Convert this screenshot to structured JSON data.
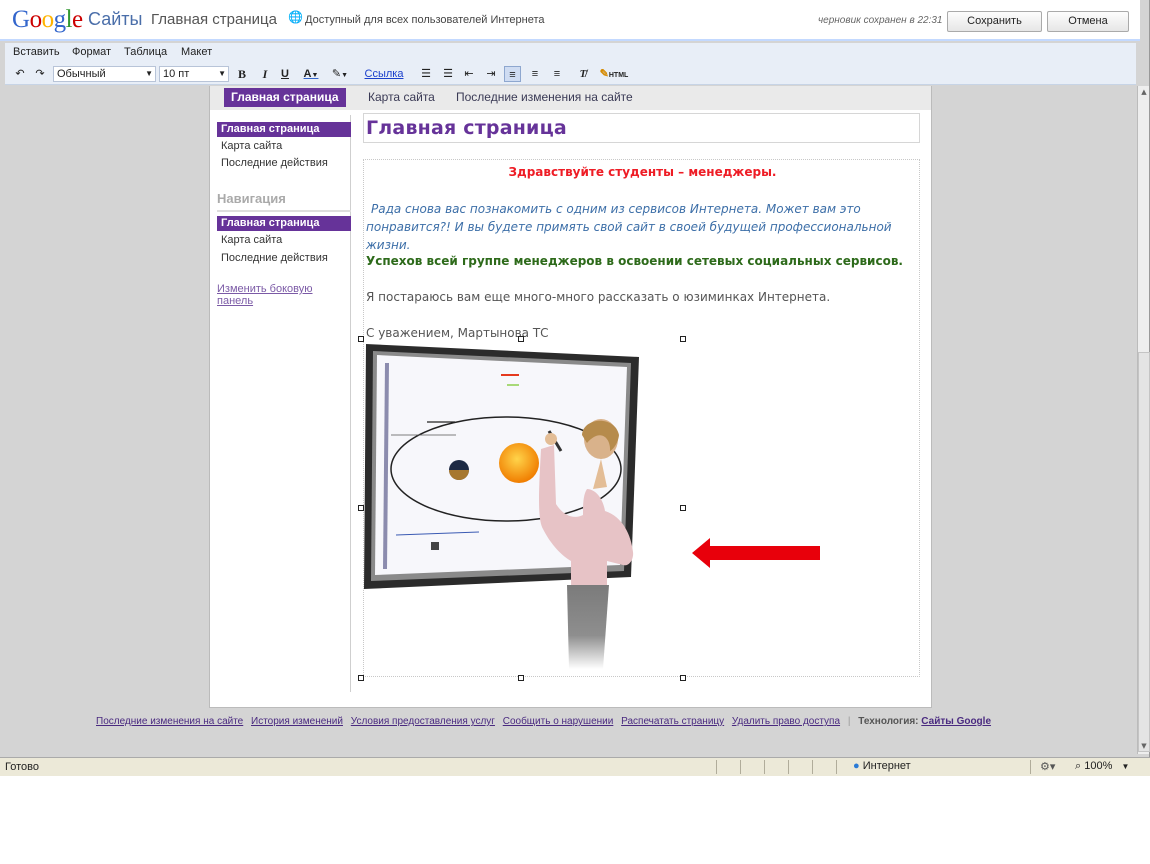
{
  "header": {
    "logo": "Google",
    "product": "Сайты",
    "page_name": "Главная страница",
    "access_text": "Доступный для всех пользователей Интернета",
    "draft_text": "черновик сохранен в 22:31",
    "save_label": "Сохранить",
    "cancel_label": "Отмена"
  },
  "menu": [
    "Вставить",
    "Формат",
    "Таблица",
    "Макет"
  ],
  "toolbar": {
    "style_value": "Обычный",
    "size_value": "10 пт",
    "bold": "B",
    "italic": "I",
    "underline": "U",
    "text_color": "A",
    "link_label": "Ссылка",
    "html_label": "HTML"
  },
  "tabs": [
    "Главная страница",
    "Карта сайта",
    "Последние изменения на сайте"
  ],
  "sidebar": {
    "top_items": [
      "Главная страница",
      "Карта сайта",
      "Последние действия"
    ],
    "nav_title": "Навигация",
    "nav_items": [
      "Главная страница",
      "Карта сайта",
      "Последние действия"
    ],
    "edit_link": "Изменить боковую панель"
  },
  "page": {
    "title": "Главная страница",
    "greeting": "Здравствуйте студенты – менеджеры.",
    "intro": "Рада снова вас познакомить с одним из сервисов Интернета. Может вам это понравится?! И вы будете примять свой сайт в своей будущей профессиональной жизни.",
    "wish": "Успехов всей группе менеджеров в освоении сетевых социальных сервисов.",
    "promise": "Я постараюсь вам еще много-много рассказать о юзиминках Интернета.",
    "signature": "С уважением, Мартынова ТС"
  },
  "footer": {
    "links": [
      "Последние изменения на сайте",
      "История изменений",
      "Условия предоставления услуг",
      "Сообщить о нарушении",
      "Распечатать страницу",
      "Удалить право доступа"
    ],
    "tech_label": "Технология:",
    "tech_link": "Сайты Google"
  },
  "status": {
    "ready": "Готово",
    "zone": "Интернет",
    "zoom": "100%"
  },
  "colors": {
    "accent": "#663399",
    "greeting": "#ee1c25",
    "intro": "#3d6fa8",
    "wish": "#2d6a1a",
    "arrow": "#e8000b"
  }
}
